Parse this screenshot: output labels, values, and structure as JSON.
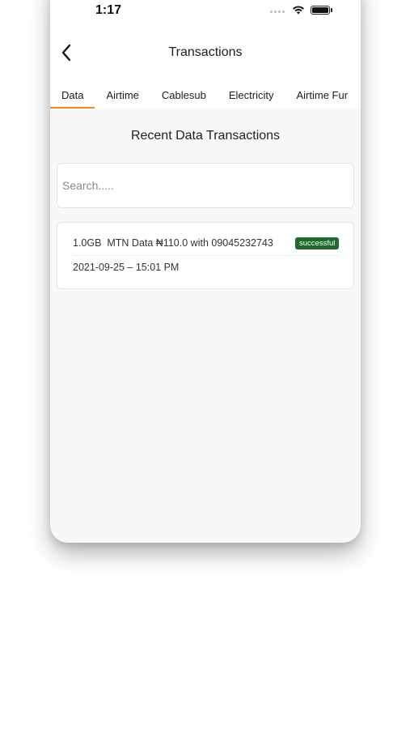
{
  "status_bar": {
    "time": "1:17",
    "icons": [
      "signal-dots-icon",
      "wifi-icon",
      "battery-icon"
    ]
  },
  "header": {
    "title": "Transactions",
    "back_icon": "chevron-left-icon"
  },
  "tabs": [
    {
      "label": "Data",
      "active": true
    },
    {
      "label": "Airtime",
      "active": false
    },
    {
      "label": "Cablesub",
      "active": false
    },
    {
      "label": "Electricity",
      "active": false
    },
    {
      "label": "Airtime Fur",
      "active": false
    }
  ],
  "section_title": "Recent Data Transactions",
  "search": {
    "placeholder": "Search.....",
    "value": ""
  },
  "transactions": [
    {
      "description": "1.0GB  MTN Data ₦110.0 with 09045232743",
      "status": "successful",
      "date": "2021-09-25 – 15:01 PM"
    }
  ],
  "colors": {
    "accent": "#f08a24",
    "status_success": "#1e6b2c",
    "background": "#f8f8f8"
  }
}
